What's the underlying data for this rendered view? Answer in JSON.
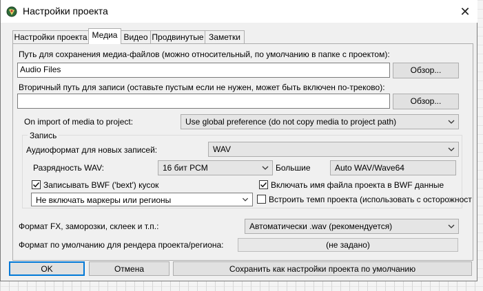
{
  "window": {
    "title": "Настройки проекта",
    "close_glyph": "✕"
  },
  "tabs": [
    {
      "label": "Настройки проекта"
    },
    {
      "label": "Медиа"
    },
    {
      "label": "Видео"
    },
    {
      "label": "Продвинутые"
    },
    {
      "label": "Заметки"
    }
  ],
  "media": {
    "path_label": "Путь для сохранения медиа-файлов (можно относительный, по умолчанию в папке с проектом):",
    "path_value": "Audio Files",
    "browse1": "Обзор...",
    "secondary_label": "Вторичный путь для записи (оставьте пустым если не нужен, может быть включен по-треково):",
    "secondary_value": "",
    "browse2": "Обзор...",
    "import_label": "On import of media to project:",
    "import_value": "Use global preference (do not copy media to project path)"
  },
  "record": {
    "group_title": "Запись",
    "format_label": "Аудиоформат для новых записей:",
    "format_value": "WAV",
    "bitdepth_label": "Разрядность WAV:",
    "bitdepth_value": "16 бит PCM",
    "large_label": "Большие",
    "large_value": "Auto WAV/Wave64",
    "bwf_label": "Записывать BWF ('bext') кусок",
    "bwf_checked": true,
    "include_name_label": "Включать имя файла проекта в BWF данные",
    "include_name_checked": true,
    "markers_value": "Не включать маркеры или регионы",
    "embed_tempo_label": "Встроить темп проекта (использовать с осторожност",
    "embed_tempo_checked": false
  },
  "fx": {
    "label": "Формат FX, заморозки, склеек и т.п.:",
    "value": "Автоматически .wav (рекомендуется)"
  },
  "render": {
    "label": "Формат по умолчанию  для рендера проекта/региона:",
    "value": "(не задано)"
  },
  "buttons": {
    "ok": "OK",
    "cancel": "Отмена",
    "save_default": "Сохранить как настройки проекта по умолчанию"
  }
}
